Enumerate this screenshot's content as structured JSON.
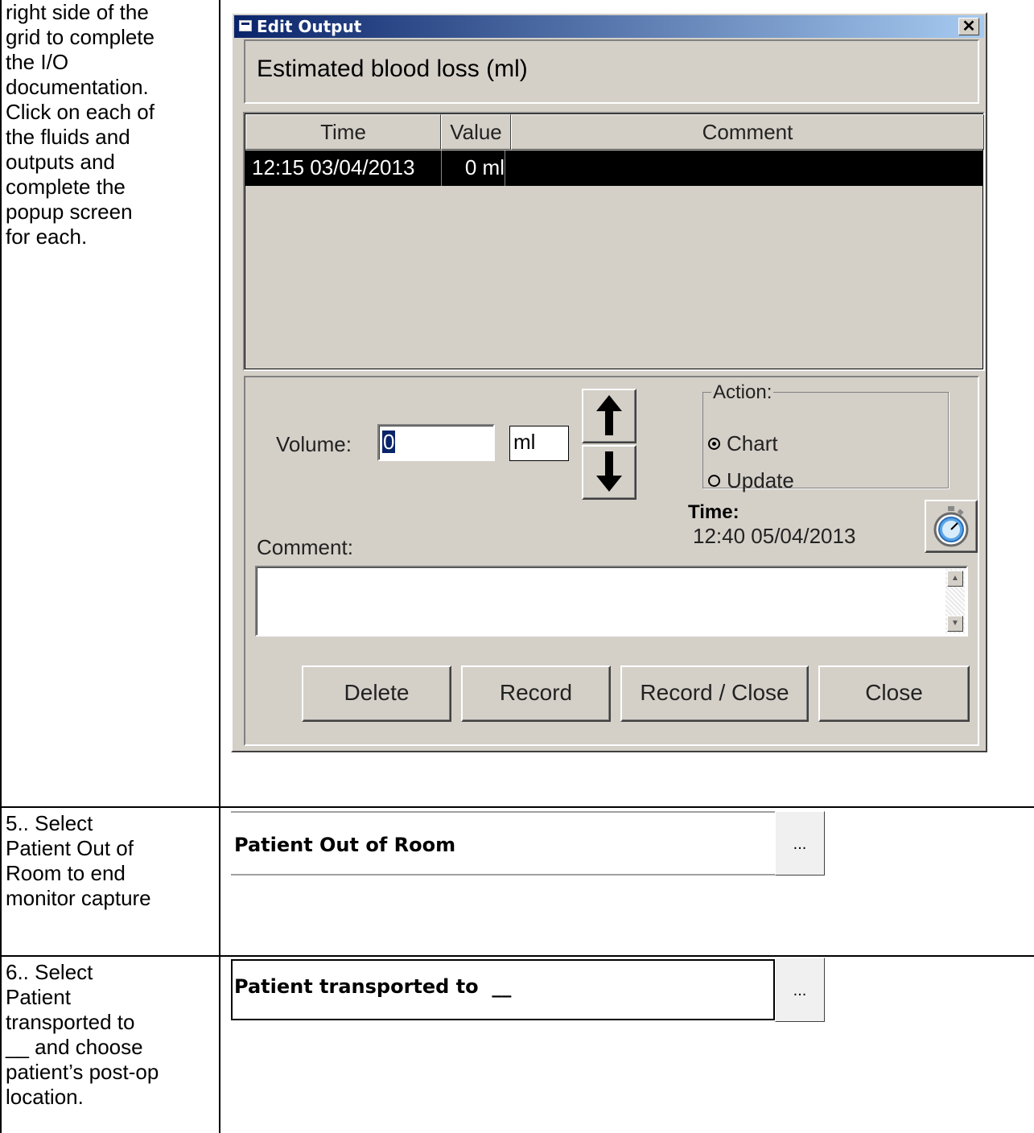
{
  "instructions": {
    "row1": "right side of the\ngrid to complete\nthe I/O\ndocumentation.\nClick on each of\nthe fluids and\noutputs and\ncomplete the\npopup screen\nfor each.",
    "row2": "5.. Select\nPatient Out of\nRoom to end\nmonitor capture",
    "row3": "6.. Select\nPatient\ntransported to\n__ and choose\npatient’s post-op\nlocation."
  },
  "dialog": {
    "title": "Edit Output",
    "close_glyph": "✕",
    "header": "Estimated blood loss (ml)",
    "grid": {
      "columns": [
        "Time",
        "Value",
        "Comment"
      ],
      "rows": [
        {
          "time": "12:15 03/04/2013",
          "value": "0 ml",
          "comment": ""
        }
      ]
    },
    "volume_label": "Volume:",
    "volume_value": "0",
    "unit": "ml",
    "up_arrow": "🡅",
    "down_arrow": "🡇",
    "action": {
      "legend": "Action:",
      "options": [
        "Chart",
        "Update"
      ],
      "selected": "Chart"
    },
    "time_label": "Time:",
    "time_value": "12:40 05/04/2013",
    "comment_label": "Comment:",
    "comment_value": "",
    "buttons": [
      "Delete",
      "Record",
      "Record / Close",
      "Close"
    ]
  },
  "fields": {
    "out_of_room": {
      "label": "Patient Out of Room",
      "button": "..."
    },
    "transported": {
      "label": "Patient transported to  __",
      "button": "..."
    }
  }
}
